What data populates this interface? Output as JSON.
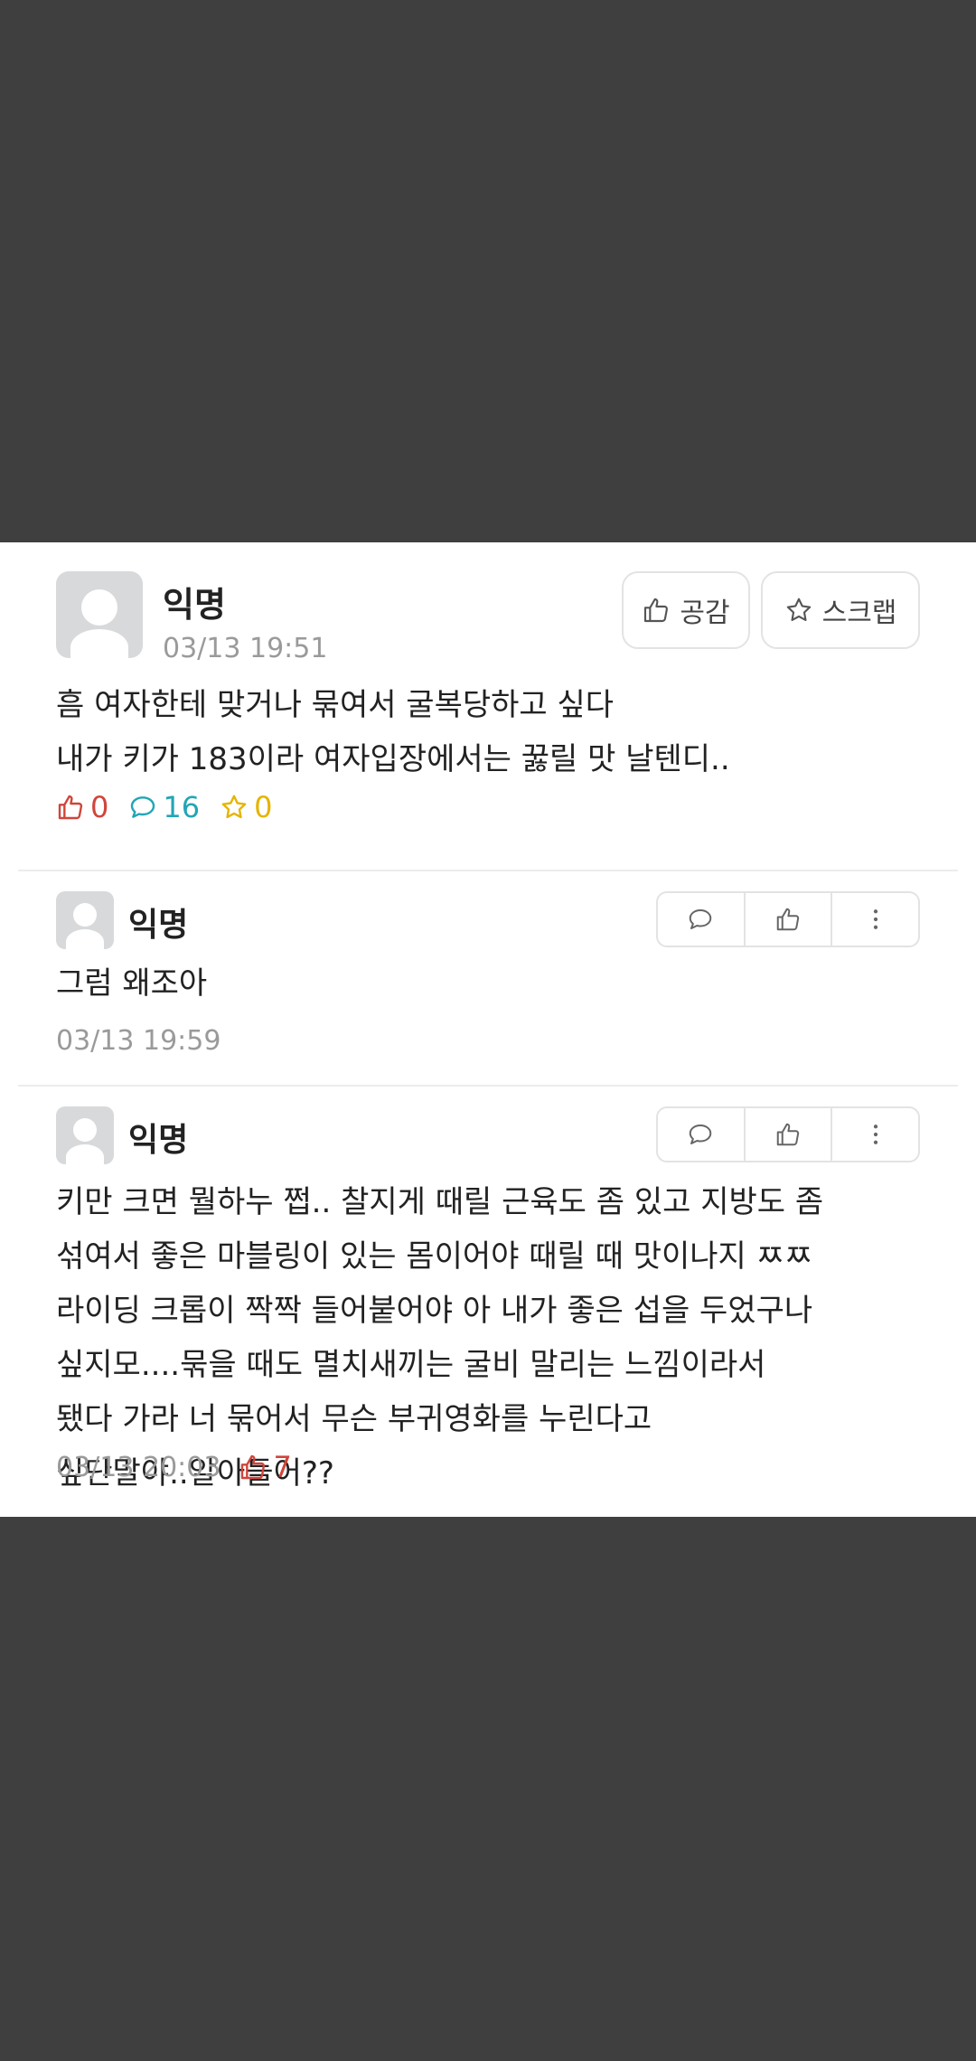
{
  "post": {
    "author": "익명",
    "timestamp": "03/13 19:51",
    "empathy_button": "공감",
    "scrap_button": "스크랩",
    "body_lines": [
      "흠 여자한테 맞거나 묶여서 굴복당하고 싶다",
      "내가 키가 183이라 여자입장에서는 꿇릴 맛 날텐디.."
    ],
    "stats": {
      "likes": "0",
      "comments": "16",
      "scraps": "0"
    }
  },
  "comments": [
    {
      "author": "익명",
      "lines": [
        "그럼 왜조아"
      ],
      "timestamp": "03/13 19:59"
    },
    {
      "author": "익명",
      "lines": [
        "키만 크면 뭘하누 쩝.. 찰지게 때릴 근육도 좀 있고 지방도 좀",
        "섞여서 좋은 마블링이 있는 몸이어야 때릴 때 맛이나지 ㅉㅉ",
        "라이딩 크롭이 짝짝 들어붙어야 아 내가 좋은 섭을 두었구나",
        "싶지모....묶을 때도 멸치새끼는 굴비 말리는 느낌이라서",
        "됐다 가라 너 묶어서 무슨 부귀영화를 누린다고",
        "싶단말야..알아들어??"
      ],
      "timestamp": "03/13 20:03",
      "likes": "7"
    }
  ],
  "icons": {
    "thumbs_up": "thumbs-up-icon",
    "comment": "comment-bubble-icon",
    "star": "star-icon",
    "more": "more-vertical-icon"
  },
  "colors": {
    "like": "#d0453a",
    "comment": "#21a6b5",
    "scrap": "#e5b400",
    "timestamp": "#9a9a9a"
  }
}
